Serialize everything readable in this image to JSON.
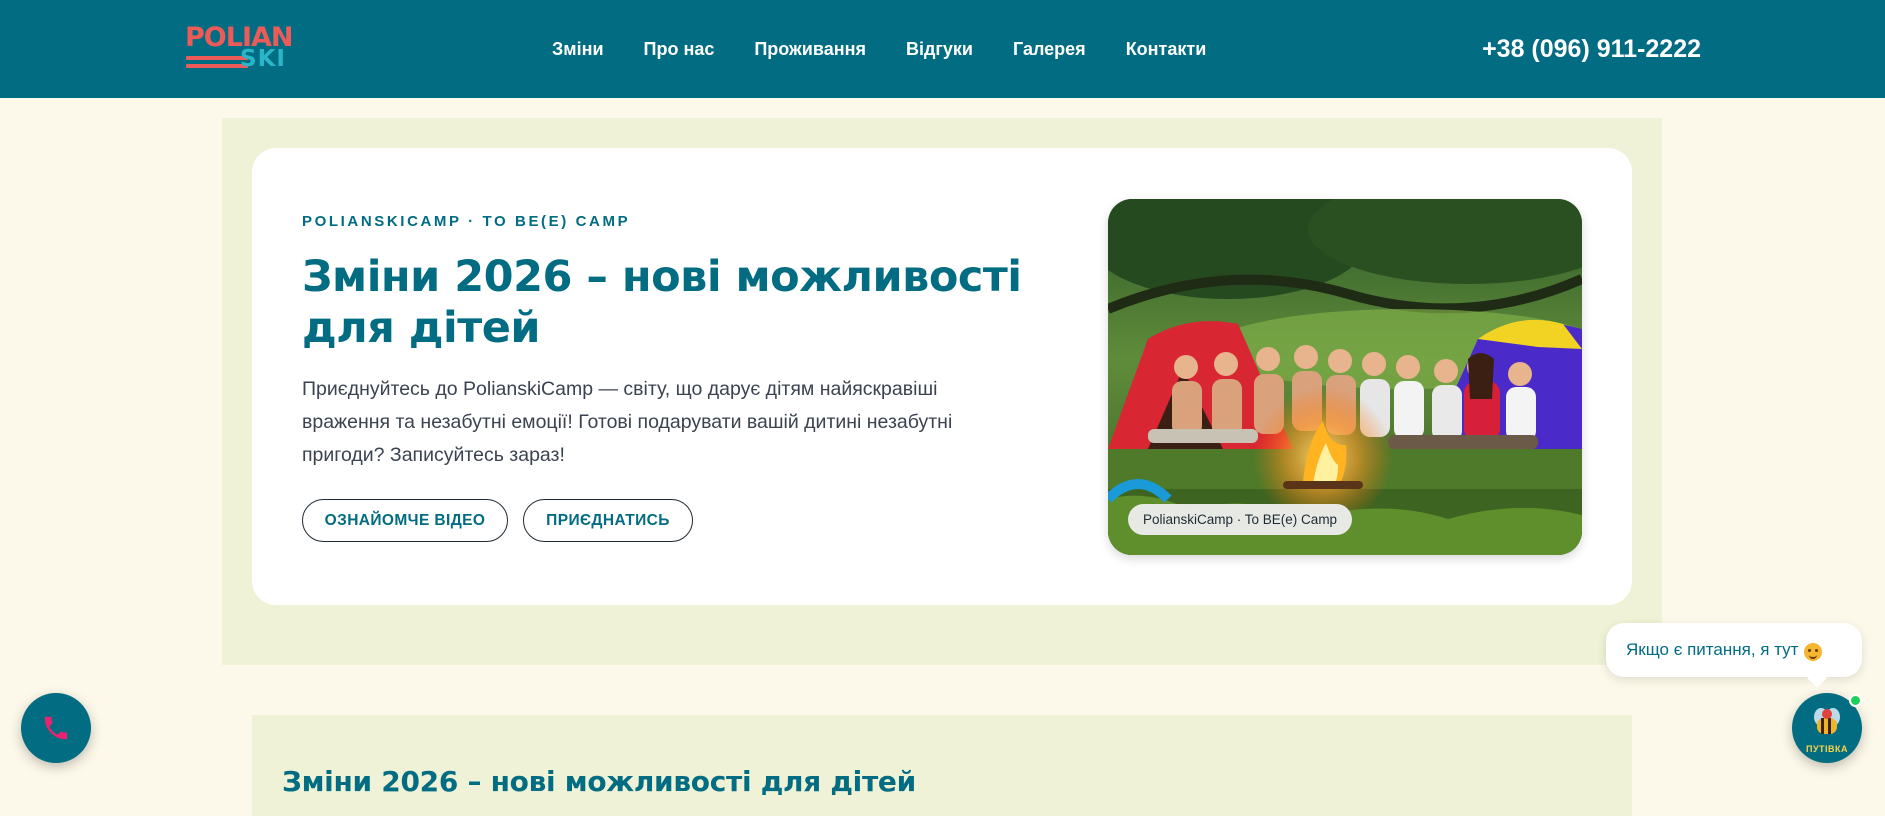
{
  "header": {
    "logo_top": "POLIAN",
    "logo_bottom": "SKI",
    "nav": [
      {
        "label": "Зміни"
      },
      {
        "label": "Про нас"
      },
      {
        "label": "Проживання"
      },
      {
        "label": "Відгуки"
      },
      {
        "label": "Галерея"
      },
      {
        "label": "Контакти"
      }
    ],
    "phone": "+38 (096) 911-2222"
  },
  "hero": {
    "eyebrow": "POLIANSKICAMP · TO BE(E) CAMP",
    "title": "Зміни 2026 – нові можливості для дітей",
    "description": "Приєднуйтесь до PolianskiCamp — світу, що дарує дітям найяскравіші враження та незабутні емоції! Готові подарувати вашій дитині незабутні пригоди? Записуйтесь зараз!",
    "btn_video": "ОЗНАЙОМЧЕ ВІДЕО",
    "btn_join": "ПРИЄДНАТИСЬ",
    "photo_caption": "PolianskiCamp · To BE(e) Camp"
  },
  "section2": {
    "title": "Зміни 2026 – нові можливості для дітей"
  },
  "widgets": {
    "chat_message": "Якщо є питання, я тут",
    "chat_label": "ПУТІВКА"
  },
  "icons": {
    "call": "phone-icon",
    "chat": "bee-icon",
    "emoji": "grinning-face-icon"
  },
  "colors": {
    "brand": "#026c82",
    "logo_red": "#ec5b57",
    "logo_cyan": "#2ab5c9",
    "background": "#fdf9ea",
    "band": "#eff2d6",
    "call_icon": "#e8246f",
    "online": "#1fcf5c"
  }
}
